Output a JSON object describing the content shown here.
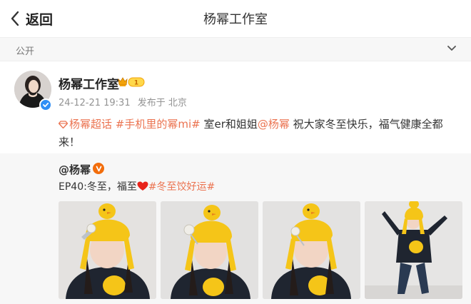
{
  "nav": {
    "back_label": "返回",
    "title": "杨幂工作室"
  },
  "visibility": {
    "label": "公开"
  },
  "post": {
    "author": "杨幂工作室",
    "badge_level": "1",
    "time": "24-12-21 19:31",
    "source": "发布于 北京",
    "tag1": "杨幂超话",
    "tag2": "#手机里的幂mi#",
    "text_part1": " 室er和姐姐",
    "mention": "@杨幂",
    "text_part2": " 祝大家冬至快乐，福气健康全都来！"
  },
  "repost": {
    "author": "@杨幂",
    "text_prefix": "EP40:冬至，福至",
    "hashtag": "#冬至饺好运#",
    "photos": [
      "photo-1",
      "photo-2",
      "photo-3",
      "photo-4"
    ]
  },
  "colors": {
    "link": "#eb7350",
    "verified": "#2f8ef5",
    "vip": "#f26d0c",
    "heart": "#e8241c"
  }
}
